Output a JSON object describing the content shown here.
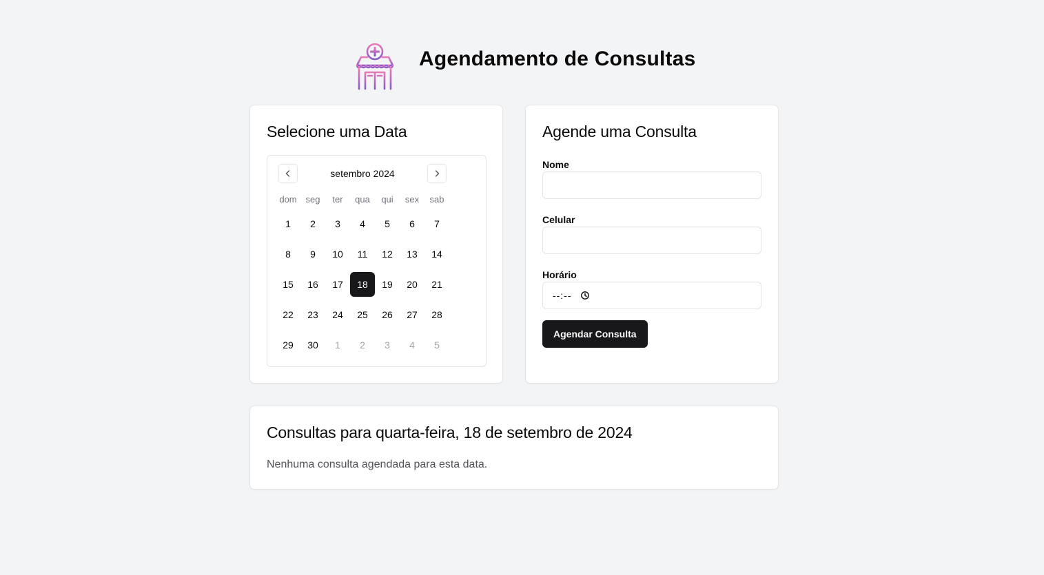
{
  "header": {
    "title": "Agendamento de Consultas",
    "logo_icon": "clinic-building-icon",
    "logo_colors": [
      "#e879b9",
      "#8b5cc6"
    ]
  },
  "calendar_card": {
    "title": "Selecione uma Data",
    "month_label": "setembro 2024",
    "prev_icon": "chevron-left-icon",
    "next_icon": "chevron-right-icon",
    "weekdays": [
      "dom",
      "seg",
      "ter",
      "qua",
      "qui",
      "sex",
      "sab"
    ],
    "weeks": [
      [
        {
          "d": "1"
        },
        {
          "d": "2"
        },
        {
          "d": "3"
        },
        {
          "d": "4"
        },
        {
          "d": "5"
        },
        {
          "d": "6"
        },
        {
          "d": "7"
        }
      ],
      [
        {
          "d": "8"
        },
        {
          "d": "9"
        },
        {
          "d": "10"
        },
        {
          "d": "11"
        },
        {
          "d": "12"
        },
        {
          "d": "13"
        },
        {
          "d": "14"
        }
      ],
      [
        {
          "d": "15"
        },
        {
          "d": "16"
        },
        {
          "d": "17"
        },
        {
          "d": "18",
          "selected": true
        },
        {
          "d": "19"
        },
        {
          "d": "20"
        },
        {
          "d": "21"
        }
      ],
      [
        {
          "d": "22"
        },
        {
          "d": "23"
        },
        {
          "d": "24"
        },
        {
          "d": "25"
        },
        {
          "d": "26"
        },
        {
          "d": "27"
        },
        {
          "d": "28"
        }
      ],
      [
        {
          "d": "29"
        },
        {
          "d": "30"
        },
        {
          "d": "1",
          "outside": true
        },
        {
          "d": "2",
          "outside": true
        },
        {
          "d": "3",
          "outside": true
        },
        {
          "d": "4",
          "outside": true
        },
        {
          "d": "5",
          "outside": true
        }
      ]
    ],
    "selected_color": "#18181b"
  },
  "form_card": {
    "title": "Agende uma Consulta",
    "name_label": "Nome",
    "name_value": "",
    "phone_label": "Celular",
    "phone_value": "",
    "time_label": "Horário",
    "time_value": "--:--",
    "time_icon": "clock-icon",
    "submit_label": "Agendar Consulta"
  },
  "appointments_card": {
    "title": "Consultas para quarta-feira, 18 de setembro de 2024",
    "empty_message": "Nenhuma consulta agendada para esta data."
  }
}
